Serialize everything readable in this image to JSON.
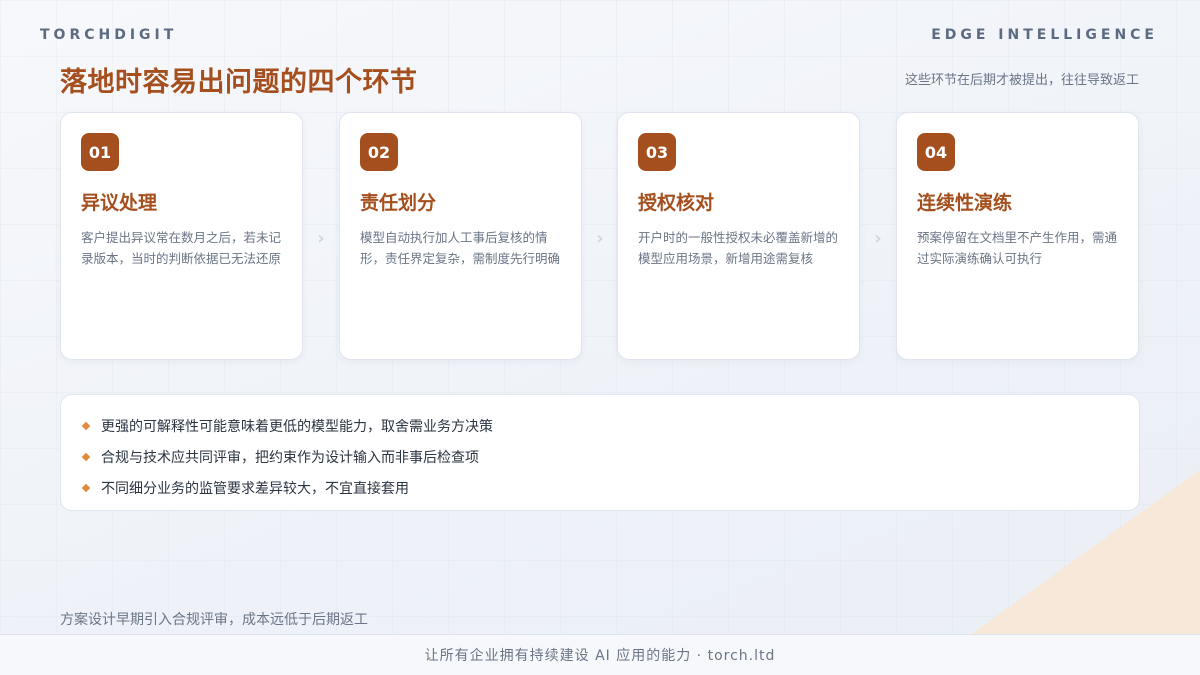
{
  "brand": {
    "left": "TORCHDIGIT",
    "right": "EDGE INTELLIGENCE"
  },
  "header": {
    "title": "落地时容易出问题的四个环节",
    "subtitle": "这些环节在后期才被提出，往往导致返工"
  },
  "cards": [
    {
      "num": "01",
      "title": "异议处理",
      "desc": "客户提出异议常在数月之后，若未记录版本，当时的判断依据已无法还原"
    },
    {
      "num": "02",
      "title": "责任划分",
      "desc": "模型自动执行加人工事后复核的情形，责任界定复杂，需制度先行明确"
    },
    {
      "num": "03",
      "title": "授权核对",
      "desc": "开户时的一般性授权未必覆盖新增的模型应用场景，新增用途需复核"
    },
    {
      "num": "04",
      "title": "连续性演练",
      "desc": "预案停留在文档里不产生作用，需通过实际演练确认可执行"
    }
  ],
  "chevron_glyph": "›",
  "points": [
    "更强的可解释性可能意味着更低的模型能力，取舍需业务方决策",
    "合规与技术应共同评审，把约束作为设计输入而非事后检查项",
    "不同细分业务的监管要求差异较大，不宜直接套用"
  ],
  "footer_note": "方案设计早期引入合规评审，成本远低于后期返工",
  "bottom_bar": "让所有企业拥有持续建设 AI 应用的能力 · torch.ltd",
  "colors": {
    "accent": "#a44f1d",
    "bullet": "#e08a3c",
    "peach": "#f9e6d4"
  }
}
